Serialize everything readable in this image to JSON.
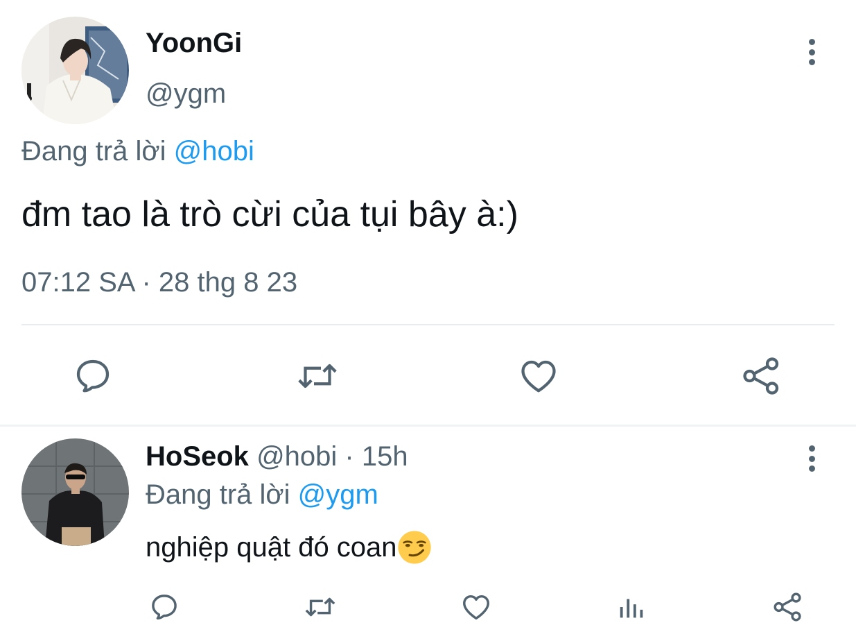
{
  "main_tweet": {
    "author_name": "YoonGi",
    "author_handle": "@ygm",
    "replying_prefix": "Đang trả lời",
    "replying_to": "@hobi",
    "text": "đm tao là trò cừi của tụi bây à:)",
    "timestamp": "07:12 SA · 28 thg 8 23",
    "actions": [
      "reply-icon",
      "retweet-icon",
      "like-icon",
      "share-icon"
    ]
  },
  "reply_tweet": {
    "author_name": "HoSeok",
    "author_handle": "@hobi",
    "separator": "·",
    "time_ago": "15h",
    "replying_prefix": "Đang trả lời",
    "replying_to": "@ygm",
    "text": "nghiệp quật đó coan",
    "emoji": "smirking-face",
    "actions": [
      "reply-icon",
      "retweet-icon",
      "like-icon",
      "analytics-icon",
      "share-icon"
    ]
  },
  "colors": {
    "primary_text": "#0f1419",
    "secondary_text": "#536471",
    "mention": "#1d9bf0",
    "divider": "#e6ecf0"
  }
}
